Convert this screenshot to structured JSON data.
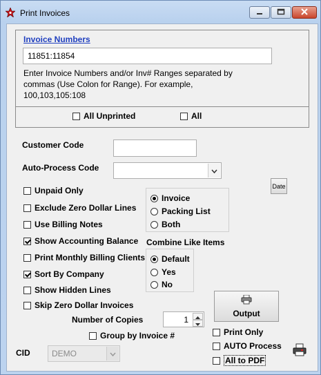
{
  "window": {
    "title": "Print Invoices"
  },
  "invoice_numbers": {
    "label": "Invoice Numbers",
    "value": "11851:11854",
    "help_text": "Enter Invoice Numbers and/or Inv# Ranges separated by commas (Use Colon for Range).  For example, 100,103,105:108",
    "all_unprinted": {
      "label": "All Unprinted",
      "checked": false
    },
    "all": {
      "label": "All",
      "checked": false
    }
  },
  "customer_code": {
    "label": "Customer Code",
    "value": ""
  },
  "auto_process_code": {
    "label": "Auto-Process Code",
    "value": ""
  },
  "date_button": {
    "label": "Date"
  },
  "options": [
    {
      "label": "Unpaid Only",
      "checked": false
    },
    {
      "label": "Exclude Zero Dollar Lines",
      "checked": false
    },
    {
      "label": "Use Billing Notes",
      "checked": false
    },
    {
      "label": "Show Accounting Balance",
      "checked": true
    },
    {
      "label": "Print Monthly Billing Clients",
      "checked": false
    },
    {
      "label": "Sort By Company",
      "checked": true
    },
    {
      "label": "Show Hidden Lines",
      "checked": false
    },
    {
      "label": "Skip Zero Dollar Invoices",
      "checked": false
    }
  ],
  "document_type": [
    {
      "label": "Invoice",
      "selected": true
    },
    {
      "label": "Packing List",
      "selected": false
    },
    {
      "label": "Both",
      "selected": false
    }
  ],
  "combine_like_items": {
    "label": "Combine Like Items",
    "options": [
      {
        "label": "Default",
        "selected": true
      },
      {
        "label": "Yes",
        "selected": false
      },
      {
        "label": "No",
        "selected": false
      }
    ]
  },
  "output_button": {
    "label": "Output"
  },
  "number_of_copies": {
    "label": "Number of Copies",
    "value": "1"
  },
  "group_by_invoice": {
    "label": "Group by Invoice #",
    "checked": false
  },
  "print_only": {
    "label": "Print Only",
    "checked": false
  },
  "auto_process": {
    "label": "AUTO Process",
    "checked": false
  },
  "all_to_pdf": {
    "label": "All to PDF",
    "checked": false
  },
  "cid": {
    "label": "CID",
    "value": "DEMO"
  }
}
